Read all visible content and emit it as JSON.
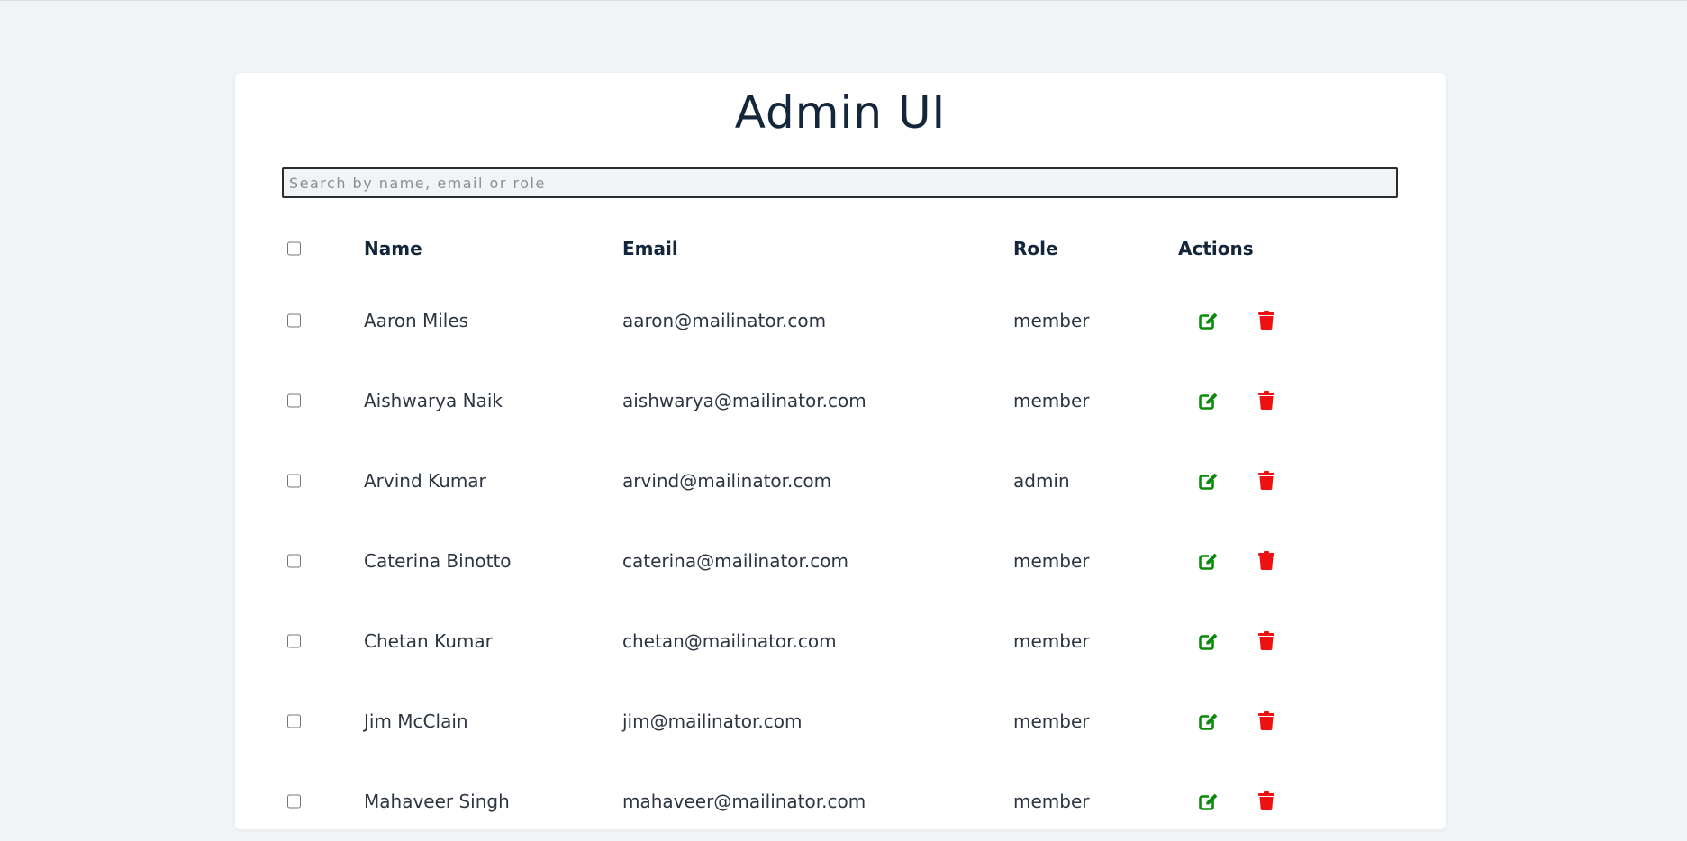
{
  "page": {
    "title": "Admin UI"
  },
  "search": {
    "placeholder": "Search by name, email or role",
    "value": ""
  },
  "table": {
    "columns": [
      "Name",
      "Email",
      "Role",
      "Actions"
    ],
    "rows": [
      {
        "name": "Aaron Miles",
        "email": "aaron@mailinator.com",
        "role": "member"
      },
      {
        "name": "Aishwarya Naik",
        "email": "aishwarya@mailinator.com",
        "role": "member"
      },
      {
        "name": "Arvind Kumar",
        "email": "arvind@mailinator.com",
        "role": "admin"
      },
      {
        "name": "Caterina Binotto",
        "email": "caterina@mailinator.com",
        "role": "member"
      },
      {
        "name": "Chetan Kumar",
        "email": "chetan@mailinator.com",
        "role": "member"
      },
      {
        "name": "Jim McClain",
        "email": "jim@mailinator.com",
        "role": "member"
      },
      {
        "name": "Mahaveer Singh",
        "email": "mahaveer@mailinator.com",
        "role": "member"
      }
    ]
  },
  "icons": {
    "edit": "edit-icon",
    "delete": "trash-icon"
  },
  "colors": {
    "edit": "#0a8a0a",
    "delete": "#ee1111",
    "background": "#f0f4f7",
    "title": "#14263a"
  }
}
